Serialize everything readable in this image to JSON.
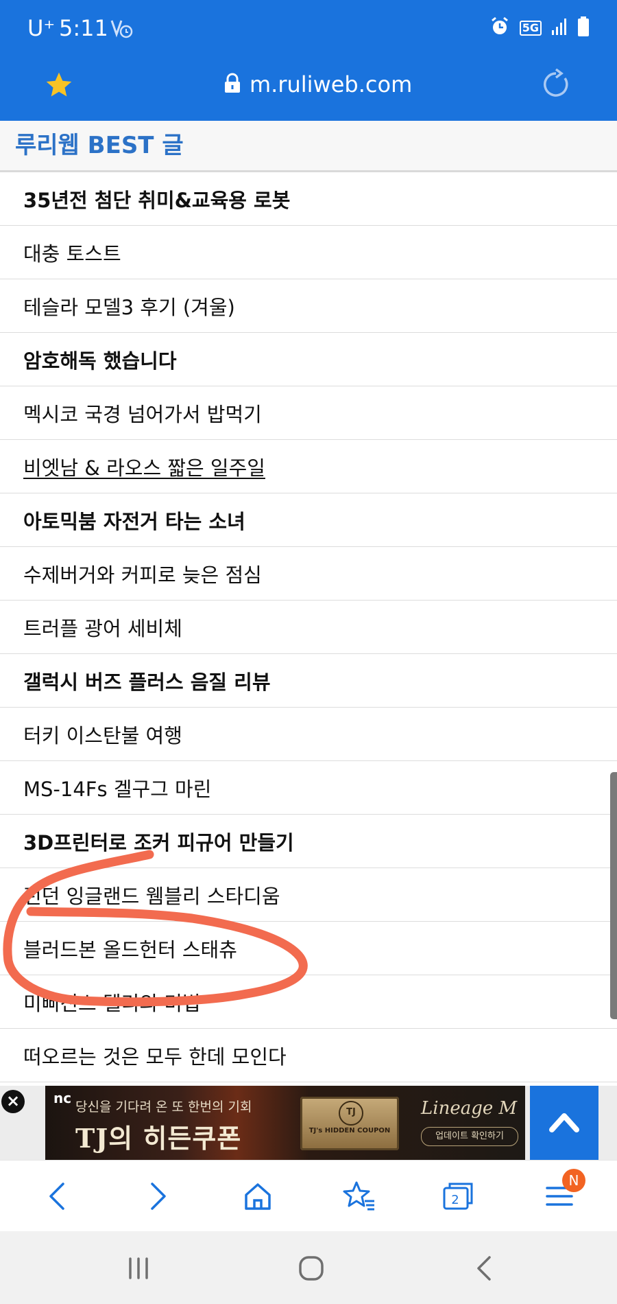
{
  "status_bar": {
    "carrier": "U⁺",
    "time": "5:11",
    "network": "5G"
  },
  "browser": {
    "url": "m.ruliweb.com"
  },
  "section": {
    "title": "루리웹 BEST 글"
  },
  "list_items": [
    {
      "title": "35년전 첨단 취미&교육용 로봇",
      "bold": true
    },
    {
      "title": "대충 토스트",
      "bold": false
    },
    {
      "title": "테슬라 모델3 후기 (겨울)",
      "bold": false
    },
    {
      "title": "암호해독 했습니다",
      "bold": true
    },
    {
      "title": "멕시코 국경 넘어가서 밥먹기",
      "bold": false
    },
    {
      "title": "비엣남 & 라오스 짧은 일주일",
      "bold": false,
      "underline": true
    },
    {
      "title": "아토믹붐 자전거 타는 소녀",
      "bold": true
    },
    {
      "title": "수제버거와 커피로 늦은 점심",
      "bold": false
    },
    {
      "title": "트러플 광어 세비체",
      "bold": false
    },
    {
      "title": "갤럭시 버즈 플러스 음질 리뷰",
      "bold": true
    },
    {
      "title": "터키 이스탄불 여행",
      "bold": false
    },
    {
      "title": "MS-14Fs 겔구그 마린",
      "bold": false
    },
    {
      "title": "3D프린터로 조커 피규어 만들기",
      "bold": true
    },
    {
      "title": "런던 잉글랜드 웸블리 스타디움",
      "bold": false
    },
    {
      "title": "블러드본 올드헌터 스태츄",
      "bold": false
    },
    {
      "title": "미삐진스 델리의 미법",
      "bold": false
    },
    {
      "title": "떠오르는 것은 모두 한데 모인다",
      "bold": false
    }
  ],
  "ad": {
    "brand": "nc",
    "subtitle": "당신을 기다려 온 또 한번의 기회",
    "headline": "TJ의 히든쿠폰",
    "coupon_text": "TJ's HIDDEN COUPON",
    "coupon_mark": "TJ",
    "logo": "Lineage M",
    "cta": "업데이트 확인하기"
  },
  "toolbar": {
    "tab_count": "2",
    "menu_badge": "N"
  },
  "colors": {
    "brand_blue": "#1a73dd",
    "title_blue": "#2c72c7",
    "annotation": "#f26b4f",
    "badge": "#f26322"
  },
  "icons": {
    "favorite": "star-icon",
    "secure": "lock-icon",
    "reload": "reload-icon",
    "back": "chevron-left-icon",
    "forward": "chevron-right-icon",
    "home": "home-icon",
    "bookmarks": "star-list-icon",
    "tabs": "tabs-icon",
    "menu": "hamburger-icon"
  }
}
